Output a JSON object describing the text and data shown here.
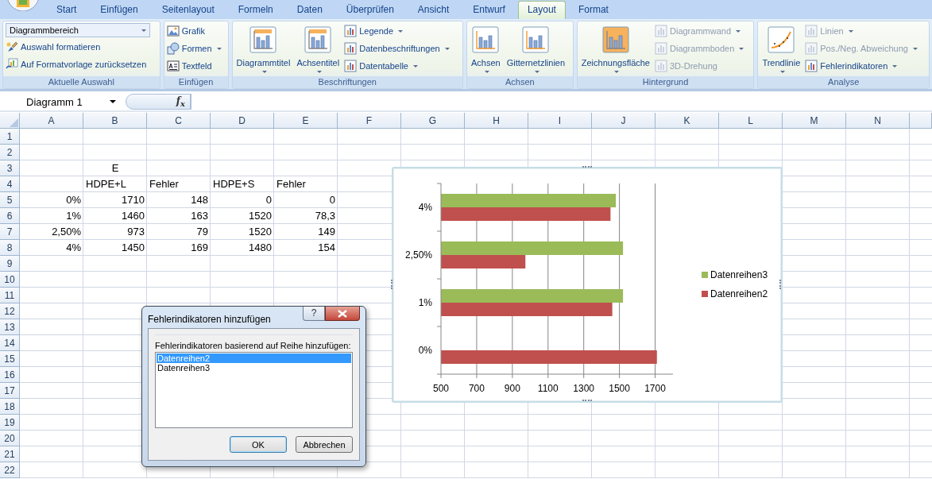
{
  "ribbon": {
    "tabs": [
      {
        "label": "Start",
        "selected": false
      },
      {
        "label": "Einfügen",
        "selected": false
      },
      {
        "label": "Seitenlayout",
        "selected": false
      },
      {
        "label": "Formeln",
        "selected": false
      },
      {
        "label": "Daten",
        "selected": false
      },
      {
        "label": "Überprüfen",
        "selected": false
      },
      {
        "label": "Ansicht",
        "selected": false
      },
      {
        "label": "Entwurf",
        "selected": false
      },
      {
        "label": "Layout",
        "selected": true
      },
      {
        "label": "Format",
        "selected": false
      }
    ],
    "groups": [
      {
        "label": "Aktuelle Auswahl",
        "items": [
          {
            "kind": "combo",
            "label": "Diagrammbereich",
            "dropdown": true,
            "disabled": false
          },
          {
            "kind": "small",
            "label": "Auswahl formatieren",
            "dropdown": false,
            "disabled": false
          },
          {
            "kind": "small",
            "label": "Auf Formatvorlage zurücksetzen",
            "dropdown": false,
            "disabled": false
          }
        ]
      },
      {
        "label": "Einfügen",
        "items": [
          {
            "kind": "small",
            "label": "Grafik",
            "dropdown": false,
            "disabled": false
          },
          {
            "kind": "small",
            "label": "Formen",
            "dropdown": true,
            "disabled": false
          },
          {
            "kind": "small",
            "label": "Textfeld",
            "dropdown": false,
            "disabled": false
          }
        ]
      },
      {
        "label": "Beschriftungen",
        "items": [
          {
            "kind": "large",
            "label": "Diagrammtitel",
            "dropdown": true,
            "disabled": false
          },
          {
            "kind": "large",
            "label": "Achsentitel",
            "dropdown": true,
            "disabled": false
          },
          {
            "kind": "small",
            "label": "Legende",
            "dropdown": true,
            "disabled": false
          },
          {
            "kind": "small",
            "label": "Datenbeschriftungen",
            "dropdown": true,
            "disabled": false
          },
          {
            "kind": "small",
            "label": "Datentabelle",
            "dropdown": true,
            "disabled": false
          }
        ]
      },
      {
        "label": "Achsen",
        "items": [
          {
            "kind": "large",
            "label": "Achsen",
            "dropdown": true,
            "disabled": false
          },
          {
            "kind": "large",
            "label": "Gitternetzlinien",
            "dropdown": true,
            "disabled": false
          }
        ]
      },
      {
        "label": "Hintergrund",
        "items": [
          {
            "kind": "large",
            "label": "Zeichnungsfläche",
            "dropdown": true,
            "disabled": false
          },
          {
            "kind": "small",
            "label": "Diagrammwand",
            "dropdown": true,
            "disabled": true
          },
          {
            "kind": "small",
            "label": "Diagrammboden",
            "dropdown": true,
            "disabled": true
          },
          {
            "kind": "small",
            "label": "3D-Drehung",
            "dropdown": false,
            "disabled": true
          }
        ]
      },
      {
        "label": "Analyse",
        "items": [
          {
            "kind": "large",
            "label": "Trendlinie",
            "dropdown": true,
            "disabled": false
          },
          {
            "kind": "small",
            "label": "Linien",
            "dropdown": true,
            "disabled": true
          },
          {
            "kind": "small",
            "label": "Pos./Neg. Abweichung",
            "dropdown": true,
            "disabled": true
          },
          {
            "kind": "small",
            "label": "Fehlerindikatoren",
            "dropdown": true,
            "disabled": false
          }
        ]
      }
    ]
  },
  "formula_bar": {
    "name_box": "Diagramm 1",
    "function_label": "f$_{x}$"
  },
  "sheet": {
    "columns": [
      "A",
      "B",
      "C",
      "D",
      "E",
      "F",
      "G",
      "H",
      "I",
      "J",
      "K",
      "L",
      "M",
      "N"
    ],
    "rows": [
      {
        "header": "1"
      },
      {
        "header": "2"
      },
      {
        "header": "3",
        "cells": [
          null,
          {
            "text": "E",
            "kind": "heading"
          }
        ]
      },
      {
        "header": "4",
        "cells": [
          null,
          {
            "text": "HDPE+L",
            "kind": "text"
          },
          {
            "text": "Fehler",
            "kind": "text"
          },
          {
            "text": "HDPE+S",
            "kind": "text"
          },
          {
            "text": "Fehler",
            "kind": "text"
          }
        ]
      },
      {
        "header": "5",
        "cells": [
          {
            "text": "0%",
            "kind": "number"
          },
          {
            "text": "1710",
            "kind": "number"
          },
          {
            "text": "148",
            "kind": "number"
          },
          {
            "text": "0",
            "kind": "number"
          },
          {
            "text": "0",
            "kind": "number"
          }
        ]
      },
      {
        "header": "6",
        "cells": [
          {
            "text": "1%",
            "kind": "number"
          },
          {
            "text": "1460",
            "kind": "number"
          },
          {
            "text": "163",
            "kind": "number"
          },
          {
            "text": "1520",
            "kind": "number"
          },
          {
            "text": "78,3",
            "kind": "number"
          }
        ]
      },
      {
        "header": "7",
        "cells": [
          {
            "text": "2,50%",
            "kind": "number"
          },
          {
            "text": "973",
            "kind": "number"
          },
          {
            "text": "79",
            "kind": "number"
          },
          {
            "text": "1520",
            "kind": "number"
          },
          {
            "text": "149",
            "kind": "number"
          }
        ]
      },
      {
        "header": "8",
        "cells": [
          {
            "text": "4%",
            "kind": "number"
          },
          {
            "text": "1450",
            "kind": "number"
          },
          {
            "text": "169",
            "kind": "number"
          },
          {
            "text": "1480",
            "kind": "number"
          },
          {
            "text": "154",
            "kind": "number"
          }
        ]
      },
      {
        "header": "9"
      },
      {
        "header": "10"
      },
      {
        "header": "11"
      },
      {
        "header": "12"
      },
      {
        "header": "13"
      },
      {
        "header": "14"
      },
      {
        "header": "15"
      },
      {
        "header": "16"
      },
      {
        "header": "17"
      },
      {
        "header": "18"
      },
      {
        "header": "19"
      },
      {
        "header": "20"
      },
      {
        "header": "21"
      },
      {
        "header": "22"
      }
    ]
  },
  "chart": {
    "chart_data": {
      "type": "bar",
      "orientation": "horizontal",
      "categories": [
        "4%",
        "2,50%",
        "1%",
        "0%"
      ],
      "series": [
        {
          "name": "Datenreihen2",
          "color": "#c0504d",
          "values": [
            1450,
            973,
            1460,
            1710
          ]
        },
        {
          "name": "Datenreihen3",
          "color": "#9bbb59",
          "values": [
            1480,
            1520,
            1520,
            null
          ]
        }
      ],
      "xlim": [
        500,
        1800
      ],
      "xticks": [
        500,
        700,
        900,
        1100,
        1300,
        1500,
        1700
      ],
      "grid": true,
      "legend": true
    }
  },
  "dialog": {
    "title": "Fehlerindikatoren hinzufügen",
    "help_button": "?",
    "prompt": "Fehlerindikatoren basierend auf Reihe hinzufügen:",
    "list": [
      {
        "label": "Datenreihen2",
        "selected": true
      },
      {
        "label": "Datenreihen3",
        "selected": false
      }
    ],
    "buttons": [
      {
        "label": "OK",
        "default": true
      },
      {
        "label": "Abbrechen",
        "default": false
      }
    ]
  }
}
